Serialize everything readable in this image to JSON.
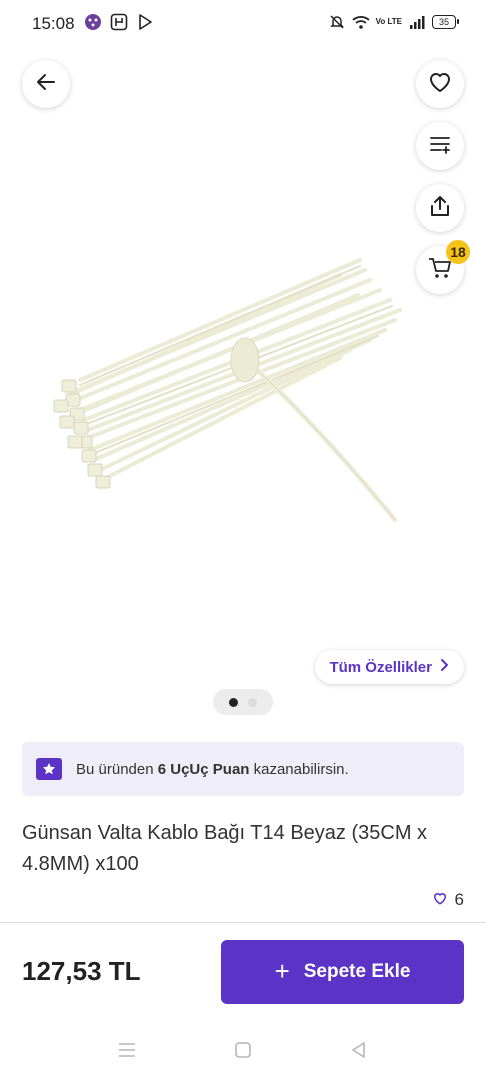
{
  "status_bar": {
    "time": "15:08",
    "battery": "35",
    "network_label": "Vo LTE"
  },
  "icons": {
    "back": "arrow-left",
    "favorite": "heart-outline",
    "compare": "list-plus",
    "share": "share-up",
    "cart": "shopping-cart",
    "points": "star",
    "likes": "heart-outline",
    "specs_chevron": "chevron-right"
  },
  "header": {
    "cart_count": "18"
  },
  "gallery": {
    "specs_label": "Tüm Özellikler",
    "image_count": 2,
    "active_index": 0
  },
  "points_banner": {
    "prefix": "Bu üründen",
    "highlight": "6 UçUç Puan",
    "suffix": "kazanabilirsin."
  },
  "product": {
    "title": "Günsan Valta Kablo Bağı T14 Beyaz (35CM x 4.8MM) x100",
    "likes": "6"
  },
  "bottom_bar": {
    "price": "127,53 TL",
    "add_label": "Sepete Ekle"
  },
  "colors": {
    "accent": "#5b34c7",
    "badge": "#f6c31b",
    "banner_bg": "#efedf8"
  }
}
